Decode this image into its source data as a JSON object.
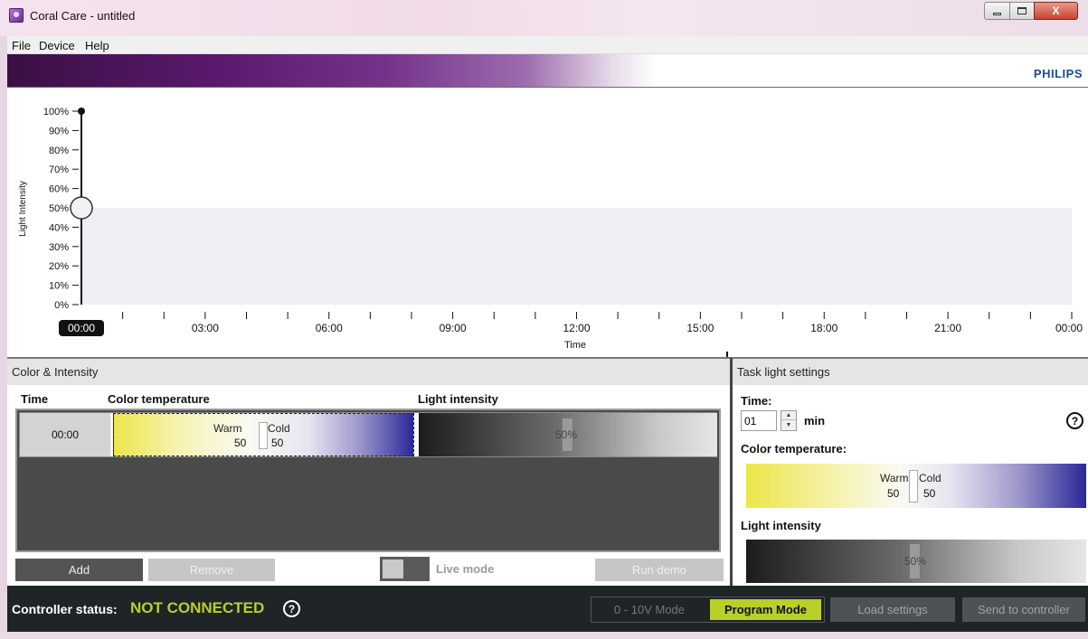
{
  "window": {
    "title": "Coral Care - untitled",
    "close_glyph": "X"
  },
  "menu": {
    "items": [
      "File",
      "Device",
      "Help"
    ]
  },
  "brand": {
    "logo_text": "PHILIPS",
    "logo_color": "#1a4b96"
  },
  "chart_data": {
    "type": "line",
    "ylabel": "Light Intensity",
    "xlabel": "Time",
    "y_ticks": [
      "0%",
      "10%",
      "20%",
      "30%",
      "40%",
      "50%",
      "60%",
      "70%",
      "80%",
      "90%",
      "100%"
    ],
    "ylim": [
      0,
      100
    ],
    "x_ticks": [
      "00:00",
      "03:00",
      "06:00",
      "09:00",
      "12:00",
      "15:00",
      "18:00",
      "21:00",
      "00:00"
    ],
    "x_range_hours": [
      0,
      24
    ],
    "series": [
      {
        "x": [
          0,
          24
        ],
        "y": [
          50,
          50
        ]
      }
    ],
    "current_time_label": "00:00",
    "selected_point": {
      "time_hours": 0,
      "intensity": 50
    },
    "slider_max_marker": 100,
    "fill_color": "#eeeef5",
    "grid": false
  },
  "color_intensity": {
    "title": "Color & Intensity",
    "columns": [
      "Time",
      "Color temperature",
      "Light intensity"
    ],
    "rows": [
      {
        "time": "00:00",
        "warm_label": "Warm",
        "cold_label": "Cold",
        "warm_value": "50",
        "cold_value": "50",
        "intensity_text": "50%",
        "intensity_level": 0.5
      }
    ],
    "buttons": {
      "add": "Add",
      "remove": "Remove",
      "run_demo": "Run demo"
    },
    "live_mode_label": "Live mode"
  },
  "task_light": {
    "title": "Task light settings",
    "time_label": "Time:",
    "time_value": "01",
    "time_unit": "min",
    "color_temp_label": "Color temperature:",
    "warm_label": "Warm",
    "cold_label": "Cold",
    "warm_value": "50",
    "cold_value": "50",
    "intensity_label": "Light intensity",
    "intensity_text": "50%",
    "intensity_level": 0.5,
    "help_glyph": "?"
  },
  "status": {
    "label": "Controller status:",
    "value": "NOT CONNECTED",
    "value_color": "#b9cf2a",
    "help_glyph": "?",
    "mode_0_10": "0 - 10V Mode",
    "mode_program": "Program Mode",
    "load_settings": "Load settings",
    "send_to_controller": "Send to controller"
  }
}
